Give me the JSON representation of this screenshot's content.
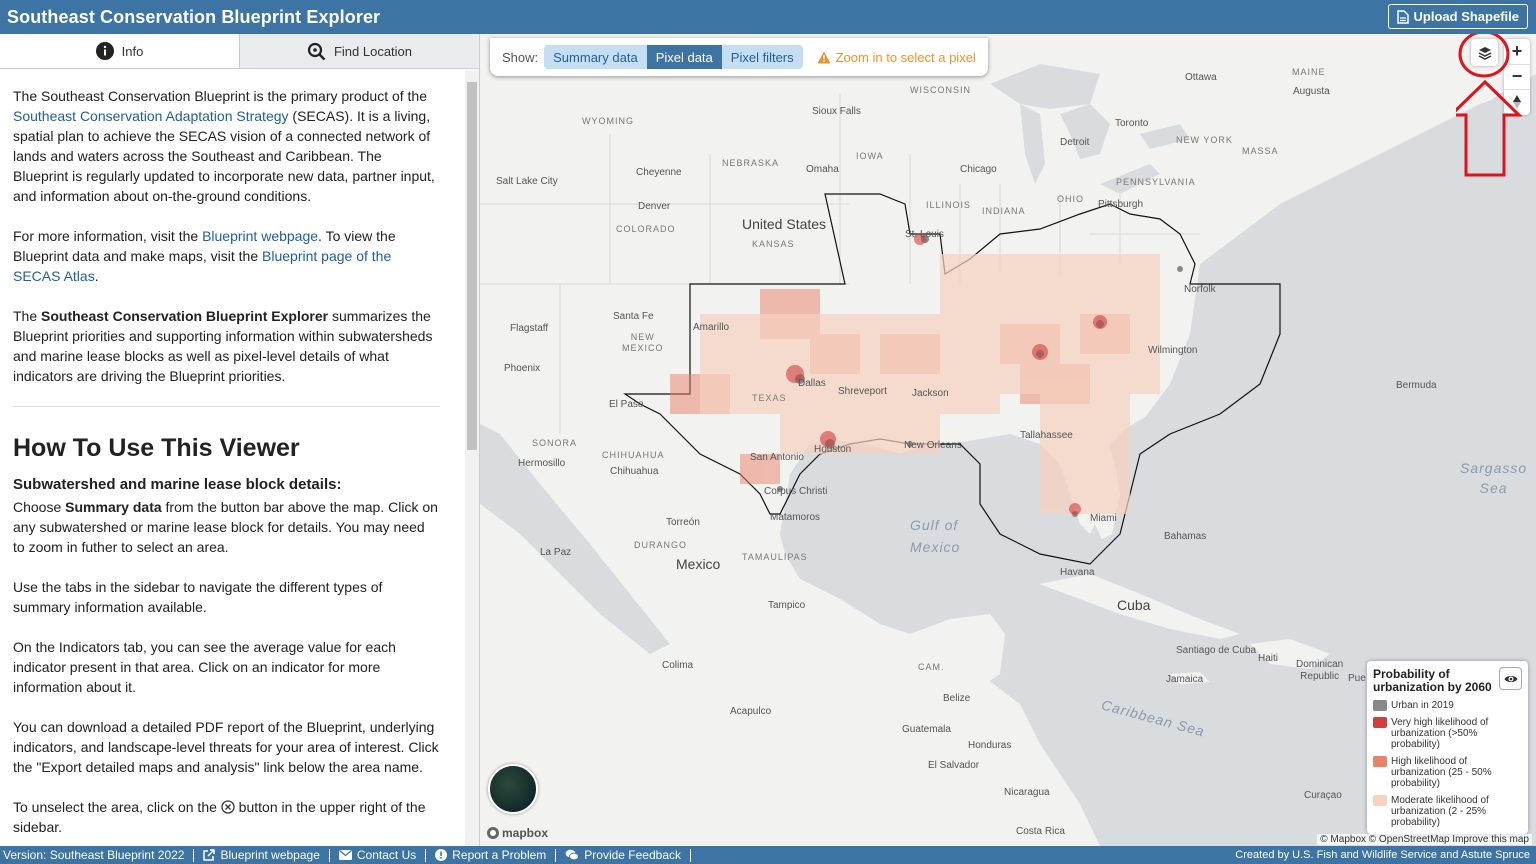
{
  "header": {
    "title": "Southeast  Conservation Blueprint Explorer",
    "upload_label": "Upload Shapefile"
  },
  "tabs": [
    {
      "label": "Info"
    },
    {
      "label": "Find Location"
    }
  ],
  "sidebar": {
    "p1_a": "The Southeast Conservation Blueprint is the primary product of the ",
    "p1_link": "Southeast Conservation Adaptation Strategy",
    "p1_b": " (SECAS). It is a living, spatial plan to achieve the SECAS vision of a connected network of lands and waters across the Southeast and Caribbean. The Blueprint is regularly updated to incorporate new data, partner input, and information about on-the-ground conditions.",
    "p2_a": "For more information, visit the ",
    "p2_link1": "Blueprint webpage",
    "p2_b": ". To view the Blueprint data and make maps, visit the ",
    "p2_link2": "Blueprint page of the SECAS Atlas",
    "p2_c": ".",
    "p3_a": "The ",
    "p3_bold": "Southeast Conservation Blueprint Explorer",
    "p3_b": " summarizes the Blueprint priorities and supporting information within subwatersheds and marine lease blocks as well as pixel-level details of what indicators are driving the Blueprint priorities.",
    "how_title": "How To Use This Viewer",
    "sub_title": "Subwatershed and marine lease block details:",
    "p4_a": "Choose ",
    "p4_bold": "Summary data",
    "p4_b": " from the button bar above the map. Click on any subwatershed or marine lease block for details. You may need to zoom in futher to select an area.",
    "p5": "Use the tabs in the sidebar to navigate the different types of summary information available.",
    "p6": "On the Indicators tab, you can see the average value for each indicator present in that area. Click on an indicator for more information about it.",
    "p7": "You can download a detailed PDF report of the Blueprint, underlying indicators, and landscape-level threats for your area of interest. Click the \"Export detailed maps and analysis\" link below the area name.",
    "p8_a": "To unselect the area, click on the ",
    "p8_b": " button in the upper right of the sidebar."
  },
  "showbar": {
    "label": "Show:",
    "buttons": [
      {
        "label": "Summary data"
      },
      {
        "label": "Pixel data"
      },
      {
        "label": "Pixel filters"
      }
    ],
    "warning": "Zoom in to select a pixel"
  },
  "legend": {
    "title": "Probability of urbanization by 2060",
    "items": [
      {
        "label": "Urban in 2019",
        "color": "#888888"
      },
      {
        "label": "Very high likelihood of urbanization (>50% probability)",
        "color": "#d13e3e"
      },
      {
        "label": "High likelihood of urbanization (25 - 50% probability)",
        "color": "#e8826a"
      },
      {
        "label": "Moderate likelihood of urbanization (2 - 25% probability)",
        "color": "#f7d2bf"
      }
    ]
  },
  "map_labels": {
    "wyoming": "WYOMING",
    "nebraska": "NEBRASKA",
    "iowa": "IOWA",
    "wisconsin": "WISCONSIN",
    "illinois": "ILLINOIS",
    "indiana": "INDIANA",
    "ohio": "OHIO",
    "pennsylvania": "PENNSYLVANIA",
    "newyork": "NEW YORK",
    "colorado": "COLORADO",
    "kansas": "KANSAS",
    "newmexico": "NEW\nMEXICO",
    "texas": "TEXAS",
    "sonora": "SONORA",
    "chihuahua": "CHIHUAHUA",
    "durango": "DURANGO",
    "tamaulipas": "TAMAULIPAS",
    "maine": "MAINE",
    "massa": "MASSA",
    "us": "United States",
    "mexico": "Mexico",
    "cuba": "Cuba",
    "gulf": "Gulf of\nMexico",
    "sargasso": "Sargasso\nSea",
    "caribbean": "Caribbean Sea",
    "cities": {
      "ottawa": "Ottawa",
      "augusta": "Augusta",
      "toronto": "Toronto",
      "detroit": "Detroit",
      "chicago": "Chicago",
      "siouxfalls": "Sioux Falls",
      "omaha": "Omaha",
      "cheyenne": "Cheyenne",
      "saltlake": "Salt Lake City",
      "denver": "Denver",
      "stlouis": "St. Louis",
      "pittsburgh": "Pittsburgh",
      "norfolk": "Norfolk",
      "santafe": "Santa Fe",
      "flagstaff": "Flagstaff",
      "phoenix": "Phoenix",
      "amarillo": "Amarillo",
      "elpaso": "El Paso",
      "dallas": "Dallas",
      "shreveport": "Shreveport",
      "jackson": "Jackson",
      "neworleans": "New Orleans",
      "houston": "Houston",
      "sanantonio": "San Antonio",
      "corpus": "Corpus Christi",
      "matamoros": "Matamoros",
      "tallahassee": "Tallahassee",
      "miami": "Miami",
      "wilmington": "Wilmington",
      "bermuda": "Bermuda",
      "bahamas": "Bahamas",
      "havana": "Havana",
      "hermosillo": "Hermosillo",
      "chihuahua": "Chihuahua",
      "torreon": "Torreón",
      "tampico": "Tampico",
      "lapaz": "La Paz",
      "colima": "Colima",
      "acapulco": "Acapulco",
      "belize": "Belize",
      "guatemala": "Guatemala",
      "honduras": "Honduras",
      "elsalvador": "El Salvador",
      "nicaragua": "Nicaragua",
      "costarica": "Costa Rica",
      "jamaica": "Jamaica",
      "haiti": "Haiti",
      "dominican": "Dominican\nRepublic",
      "santiagocuba": "Santiago de Cuba",
      "curacao": "Curaçao",
      "pr": "Pue",
      "cam": "CAM."
    }
  },
  "attribution": "© Mapbox © OpenStreetMap  Improve this map",
  "mapbox": "mapbox",
  "footer": {
    "items": [
      {
        "label": "Version: Southeast Blueprint 2022"
      },
      {
        "label": "Blueprint webpage"
      },
      {
        "label": "Contact Us"
      },
      {
        "label": "Report a Problem"
      },
      {
        "label": "Provide Feedback"
      }
    ],
    "credit": "Created by U.S. Fish and Wildlife Service and Astute Spruce"
  },
  "colors": {
    "header": "#3d74a4",
    "annotation": "#e0121b"
  }
}
